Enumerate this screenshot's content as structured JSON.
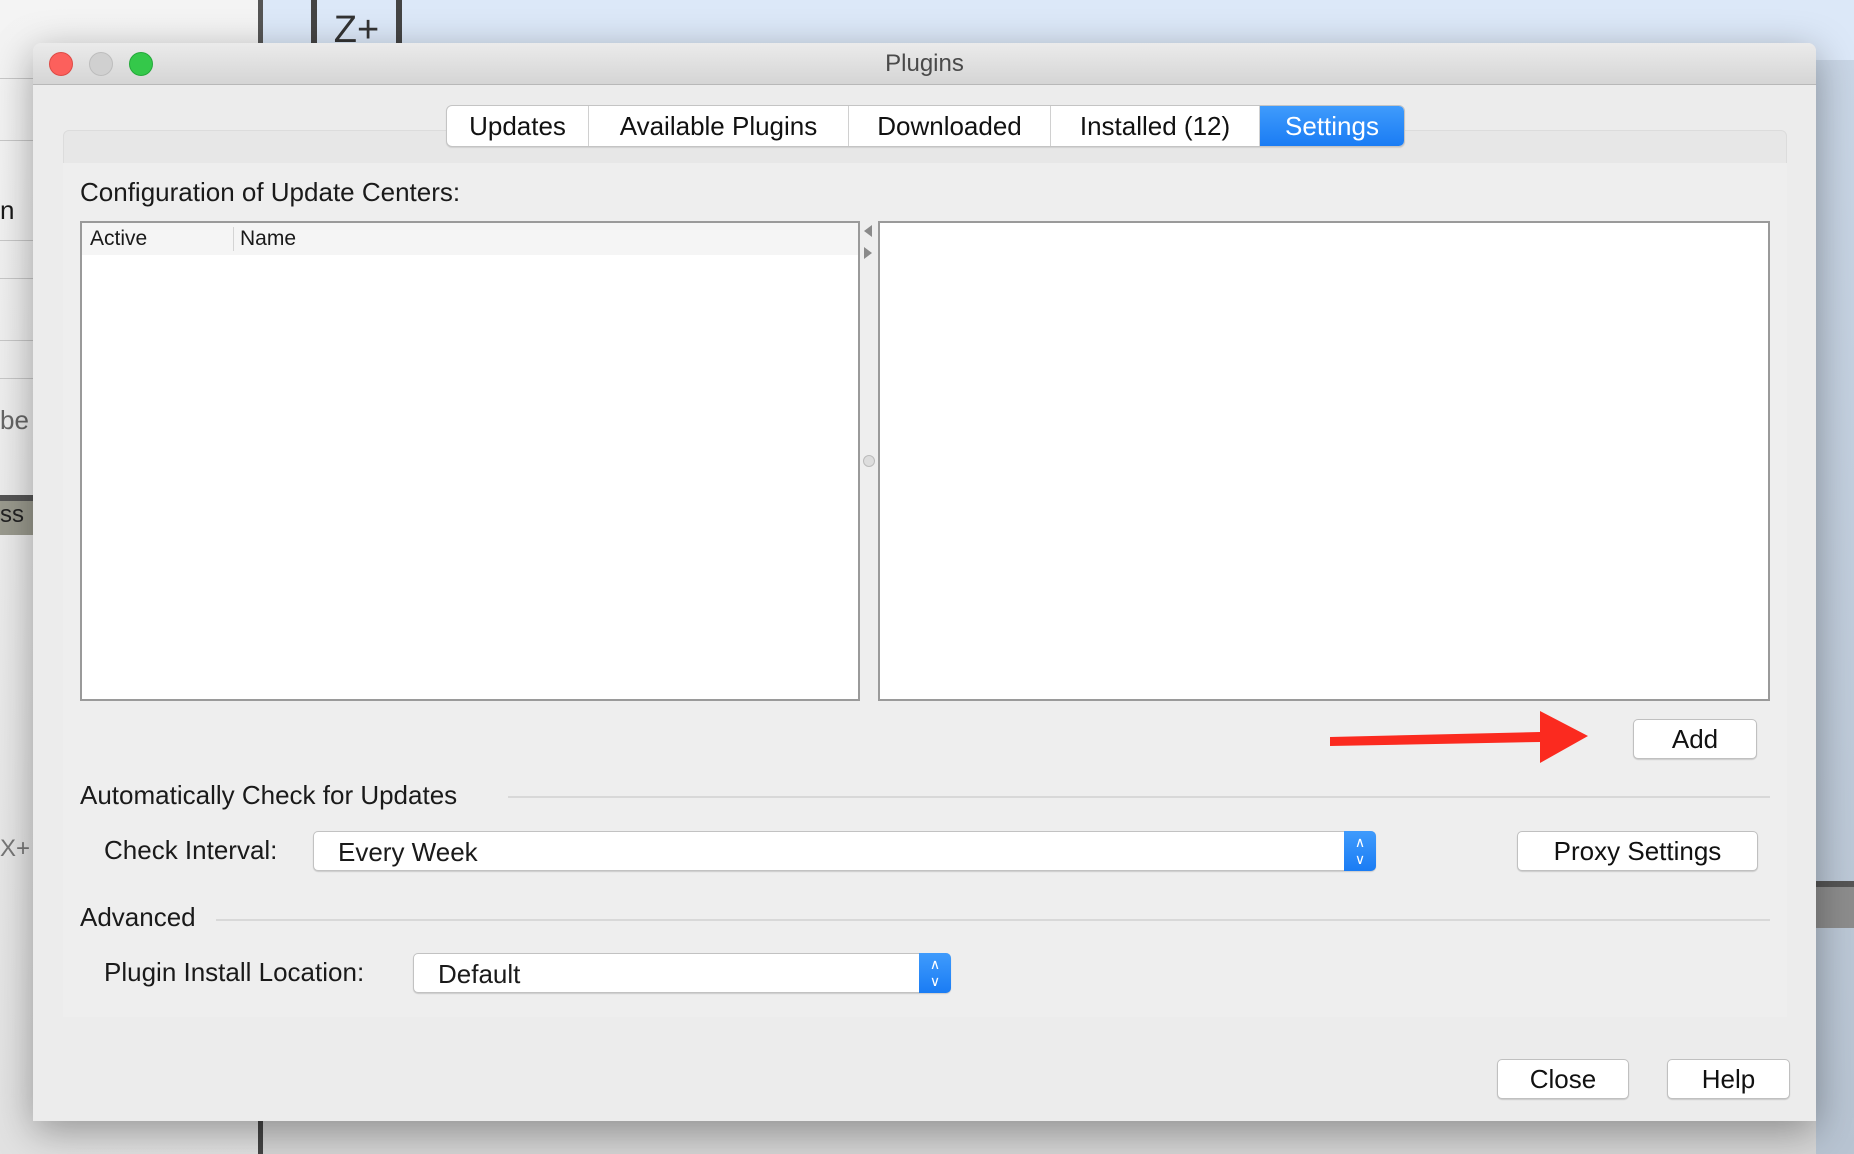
{
  "background": {
    "left_fragments": [
      "n",
      "be",
      "ss",
      "X+"
    ],
    "top_button": "Z+"
  },
  "dialog": {
    "title": "Plugins",
    "tabs": [
      {
        "label": "Updates",
        "active": false
      },
      {
        "label": "Available Plugins",
        "active": false
      },
      {
        "label": "Downloaded",
        "active": false
      },
      {
        "label": "Installed (12)",
        "active": false
      },
      {
        "label": "Settings",
        "active": true
      }
    ],
    "update_centers": {
      "heading": "Configuration of Update Centers:",
      "columns": [
        "Active",
        "Name"
      ],
      "rows": [],
      "add_label": "Add"
    },
    "auto_check": {
      "heading": "Automatically Check for Updates",
      "interval_label": "Check Interval:",
      "interval_value": "Every Week",
      "proxy_label": "Proxy Settings"
    },
    "advanced": {
      "heading": "Advanced",
      "location_label": "Plugin Install Location:",
      "location_value": "Default"
    },
    "close_label": "Close",
    "help_label": "Help"
  },
  "colors": {
    "accent": "#1a7cf4",
    "annotation_arrow": "#fb2a1f",
    "close_light": "#fc605c",
    "min_light": "#d0d0d0",
    "max_light": "#34c84a"
  }
}
